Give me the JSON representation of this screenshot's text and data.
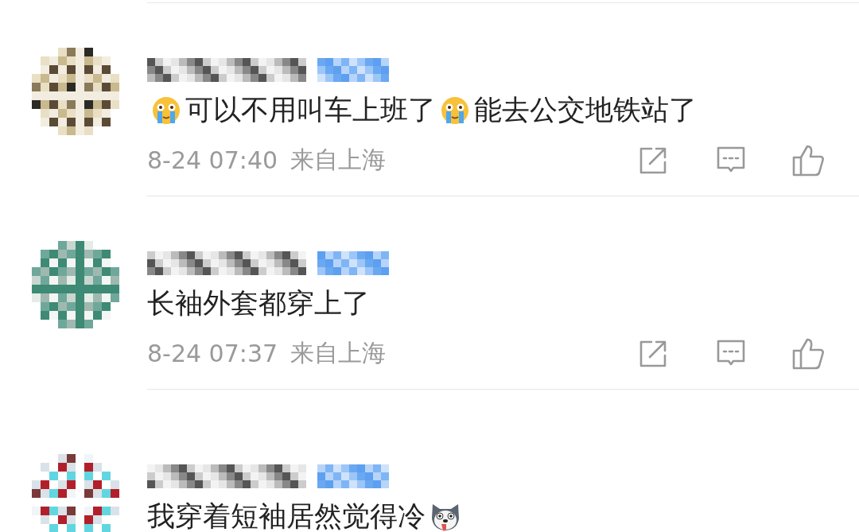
{
  "comments": [
    {
      "avatar": {
        "kind": "picture"
      },
      "content": [
        {
          "kind": "crying-face"
        },
        {
          "kind": "text",
          "text": "可以不用叫车上班了"
        },
        {
          "kind": "crying-face"
        },
        {
          "kind": "text",
          "text": "能去公交地铁站了"
        }
      ],
      "time": "8-24 07:40",
      "location": "来自上海"
    },
    {
      "avatar": {
        "kind": "picture"
      },
      "content": [
        {
          "kind": "text",
          "text": "长袖外套都穿上了"
        }
      ],
      "time": "8-24 07:37",
      "location": "来自上海"
    },
    {
      "avatar": {
        "kind": "picture"
      },
      "content": [
        {
          "kind": "text",
          "text": "我穿着短袖居然觉得冷"
        },
        {
          "kind": "dog-face"
        }
      ]
    }
  ]
}
